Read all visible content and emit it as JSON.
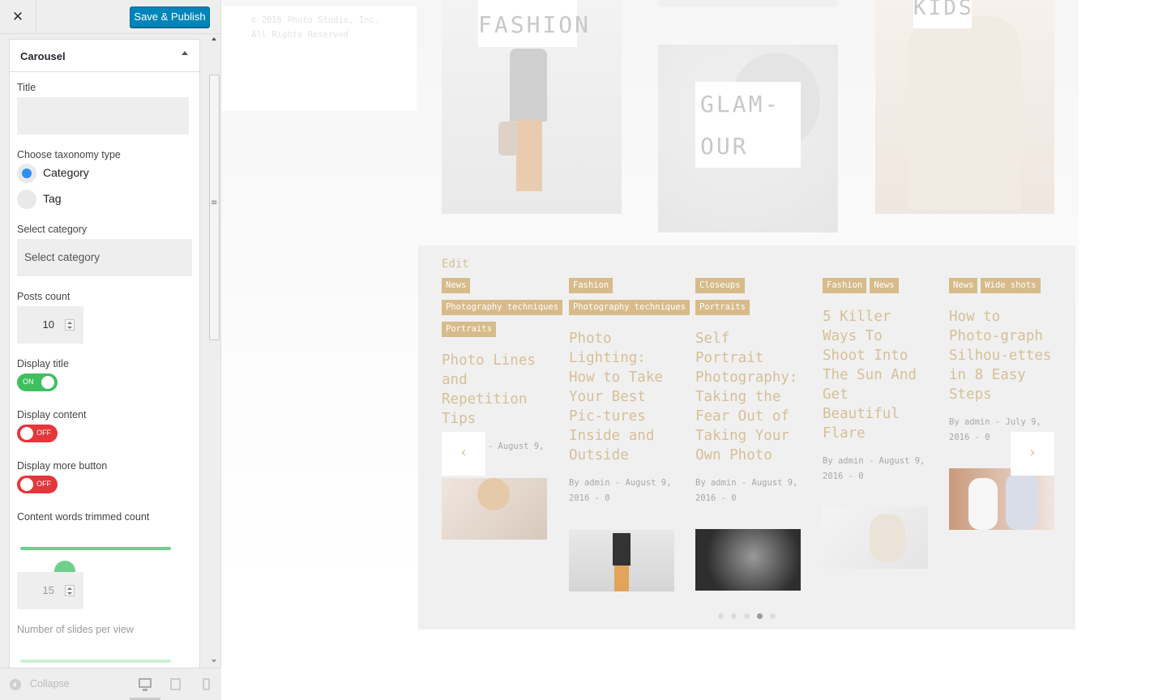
{
  "customizer": {
    "close_label": "✕",
    "publish_label": "Save & Publish",
    "section_title": "Carousel",
    "title_label": "Title",
    "title_value": "",
    "taxonomy_label": "Choose taxonomy type",
    "taxonomy_options": [
      "Category",
      "Tag"
    ],
    "taxonomy_selected": "Category",
    "select_category_label": "Select category",
    "select_category_placeholder": "Select category",
    "posts_count_label": "Posts count",
    "posts_count_value": "10",
    "display_title_label": "Display title",
    "display_title_state": "ON",
    "display_content_label": "Display content",
    "display_content_state": "OFF",
    "display_more_label": "Display more button",
    "display_more_state": "OFF",
    "trim_label": "Content words trimmed count",
    "trim_value": "15",
    "slides_label": "Number of slides per view",
    "collapse_label": "Collapse",
    "accent_blue": "#0085ba",
    "toggle_on_color": "#3ec05e",
    "toggle_off_color": "#e5363b",
    "slider_color": "#6fd08c"
  },
  "preview": {
    "copyright": "© 2016 Photo Studio, Inc. All Rights Reserved",
    "gallery": [
      {
        "label": "FASHION"
      },
      {
        "label_lines": [
          "GLAM-",
          "OUR"
        ]
      },
      {
        "label": "KIDS"
      }
    ],
    "carousel": {
      "edit_label": "Edit",
      "tag_color": "#d7bb8a",
      "title_color": "#d7bf96",
      "slides": [
        {
          "tags": [
            "News",
            "Photography techniques",
            "Portraits"
          ],
          "title": "Photo Lines and Repetition Tips",
          "meta": "By admin - August 9, 2016 - 0"
        },
        {
          "tags": [
            "Fashion",
            "Photography techniques"
          ],
          "title": "Photo Lighting: How to Take Your Best Pic-tures Inside and Outside",
          "meta": "By admin - August 9, 2016 - 0"
        },
        {
          "tags": [
            "Closeups",
            "Portraits"
          ],
          "title": "Self Portrait Photography: Taking the Fear Out of Taking Your Own Photo",
          "meta": "By admin - August 9, 2016 - 0"
        },
        {
          "tags": [
            "Fashion",
            "News"
          ],
          "title": "5 Killer Ways To Shoot Into The Sun And Get Beautiful Flare",
          "meta": "By admin - August 9, 2016 - 0"
        },
        {
          "tags": [
            "News",
            "Wide shots"
          ],
          "title": "How to Photo-graph Silhou-ettes in 8 Easy Steps",
          "meta": "By admin - July 9, 2016 - 0"
        }
      ],
      "prev_icon": "chevron-left-icon",
      "next_icon": "chevron-right-icon",
      "dots_count": 5,
      "active_dot": 4
    }
  }
}
